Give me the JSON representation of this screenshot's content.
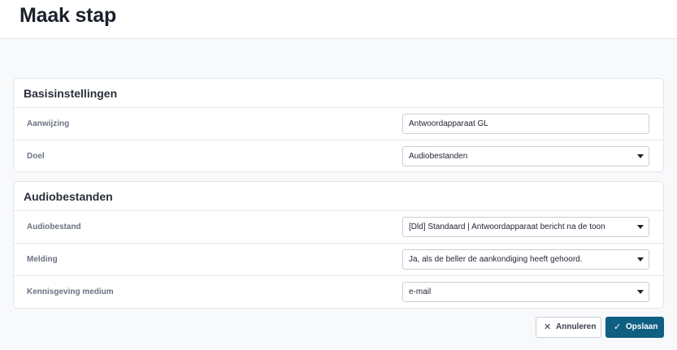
{
  "page": {
    "title": "Maak stap"
  },
  "sections": [
    {
      "title": "Basisinstellingen",
      "rows": [
        {
          "label": "Aanwijzing",
          "type": "text",
          "value": "Antwoordapparaat GL"
        },
        {
          "label": "Doel",
          "type": "select",
          "value": "Audiobestanden"
        }
      ]
    },
    {
      "title": "Audiobestanden",
      "rows": [
        {
          "label": "Audiobestand",
          "type": "select",
          "value": "[Dld] Standaard | Antwoordapparaat bericht na de toon"
        },
        {
          "label": "Melding",
          "type": "select",
          "value": "Ja, als de beller de aankondiging heeft gehoord."
        },
        {
          "label": "Kennisgeving medium",
          "type": "select",
          "value": "e-mail"
        }
      ]
    }
  ],
  "actions": {
    "cancel_label": "Annuleren",
    "save_label": "Opslaan"
  },
  "icons": {
    "cancel": "close-icon",
    "save": "check-icon"
  },
  "colors": {
    "primary": "#0f5f82",
    "background": "#f8f9fb"
  }
}
